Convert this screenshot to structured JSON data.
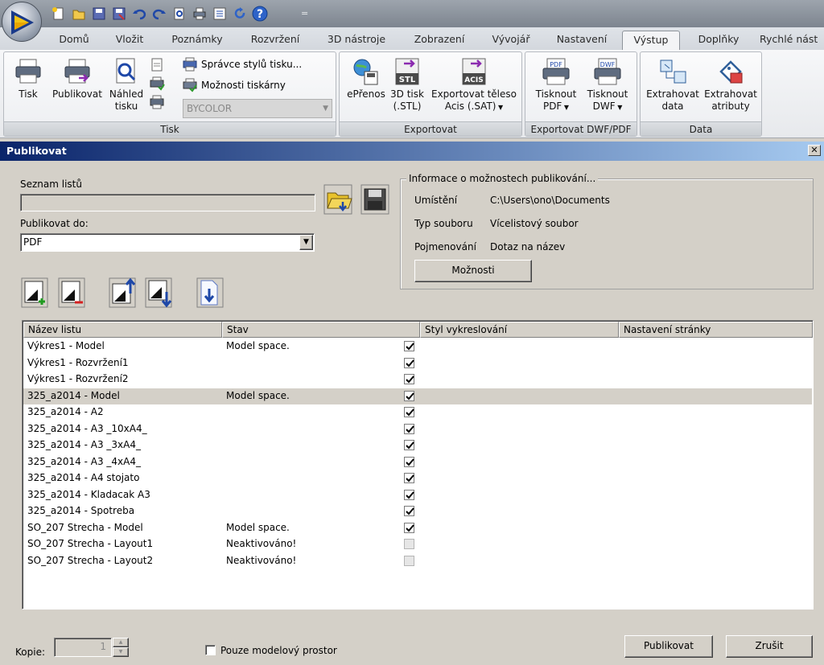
{
  "qat": {
    "icons": [
      "new-icon",
      "open-icon",
      "save-icon",
      "save-as-icon",
      "undo-icon",
      "redo-icon",
      "plot-preview-icon",
      "print-icon",
      "properties-icon",
      "refresh-icon",
      "help-icon"
    ],
    "separator": "="
  },
  "tabs": [
    "Domů",
    "Vložit",
    "Poznámky",
    "Rozvržení",
    "3D nástroje",
    "Zobrazení",
    "Vývojář",
    "Nastavení",
    "Výstup",
    "Doplňky",
    "Rychlé nást"
  ],
  "active_tab": "Výstup",
  "ribbon": {
    "tisk": {
      "label": "Tisk",
      "buttons": [
        {
          "label_1": "Tisk",
          "label_2": ""
        },
        {
          "label_1": "Publikovat",
          "label_2": ""
        },
        {
          "label_1": "Náhled",
          "label_2": "tisku"
        }
      ],
      "style_manager": "Správce stylů tisku...",
      "printer_options": "Možnosti tiskárny",
      "plot_style_combo": "BYCOLOR"
    },
    "exportovat": {
      "label": "Exportovat",
      "epreno": {
        "label_1": "ePřenos",
        "label_2": ""
      },
      "stl": {
        "label_1": "3D tisk",
        "label_2": "(.STL)",
        "icon_text": "STL"
      },
      "acis": {
        "label_1": "Exportovat těleso",
        "label_2": "Acis (.SAT)",
        "icon_text": "ACIS"
      }
    },
    "dwfpdf": {
      "label": "Exportovat DWF/PDF",
      "pdf": {
        "label_1": "Tisknout",
        "label_2": "PDF",
        "icon_text": "PDF"
      },
      "dwf": {
        "label_1": "Tisknout",
        "label_2": "DWF",
        "icon_text": "DWF"
      }
    },
    "data": {
      "label": "Data",
      "extract_data": {
        "label_1": "Extrahovat",
        "label_2": "data"
      },
      "extract_attr": {
        "label_1": "Extrahovat",
        "label_2": "atributy"
      }
    }
  },
  "dialog": {
    "title": "Publikovat",
    "close": "✕",
    "sheet_list_label": "Seznam listů",
    "sheet_list_value": "",
    "publish_to_label": "Publikovat do:",
    "publish_to_value": "PDF",
    "info": {
      "title": "Informace o možnostech publikování...",
      "location_label": "Umístění",
      "location_value": "C:\\Users\\ono\\Documents",
      "filetype_label": "Typ souboru",
      "filetype_value": "Vícelistový soubor",
      "naming_label": "Pojmenování",
      "naming_value": "Dotaz na název",
      "options_button": "Možnosti"
    },
    "columns": [
      "Název listu",
      "Stav",
      "Styl vykreslování",
      "Nastavení stránky"
    ],
    "rows": [
      {
        "name": "Výkres1 - Model",
        "status": "Model space.",
        "checked": true
      },
      {
        "name": "Výkres1 - Rozvržení1",
        "status": "",
        "checked": true
      },
      {
        "name": "Výkres1 - Rozvržení2",
        "status": "",
        "checked": true
      },
      {
        "name": "325_a2014 - Model",
        "status": "Model space.",
        "checked": true
      },
      {
        "name": "325_a2014 - A2",
        "status": "",
        "checked": true
      },
      {
        "name": "325_a2014 - A3 _10xA4_",
        "status": "",
        "checked": true
      },
      {
        "name": "325_a2014 - A3 _3xA4_",
        "status": "",
        "checked": true
      },
      {
        "name": "325_a2014 - A3 _4xA4_",
        "status": "",
        "checked": true
      },
      {
        "name": "325_a2014 - A4 stojato",
        "status": "",
        "checked": true
      },
      {
        "name": "325_a2014 - Kladacak A3",
        "status": "",
        "checked": true
      },
      {
        "name": "325_a2014 - Spotreba",
        "status": "",
        "checked": true
      },
      {
        "name": "SO_207 Strecha - Model",
        "status": "Model space.",
        "checked": true
      },
      {
        "name": "SO_207 Strecha - Layout1",
        "status": "Neaktivováno!",
        "checked": false
      },
      {
        "name": "SO_207 Strecha - Layout2",
        "status": "Neaktivováno!",
        "checked": false
      }
    ],
    "selected_row": 3,
    "copies_label": "Kopie:",
    "copies_value": "1",
    "model_only_label": "Pouze modelový prostor",
    "publish_button": "Publikovat",
    "cancel_button": "Zrušit"
  }
}
